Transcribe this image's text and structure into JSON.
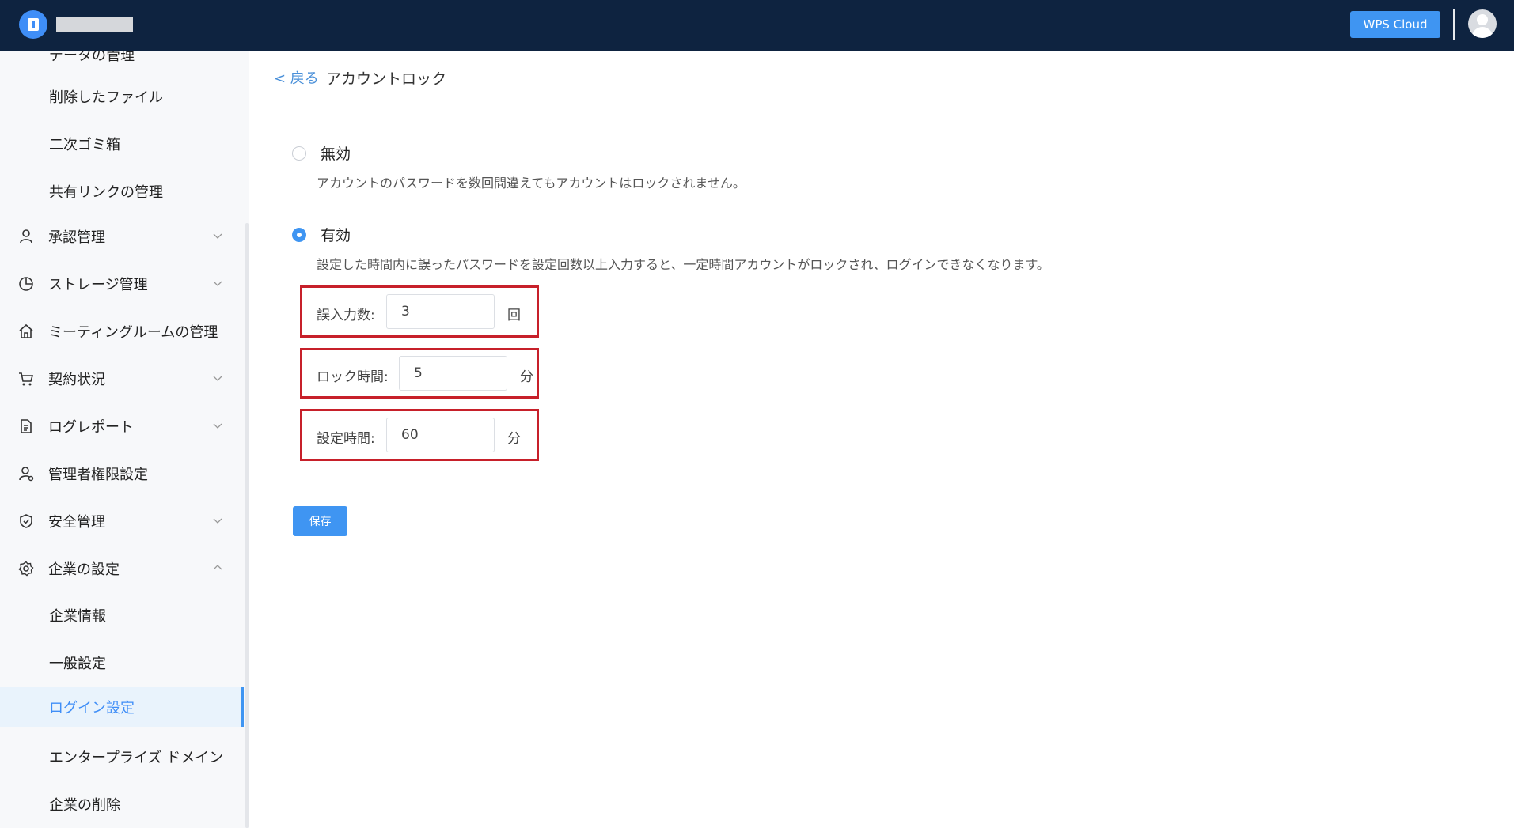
{
  "topbar": {
    "cloud_button_label": "WPS Cloud"
  },
  "sidebar": {
    "partial_label": "データの管理",
    "items": [
      {
        "label": "削除したファイル",
        "level": "sub"
      },
      {
        "label": "二次ゴミ箱",
        "level": "sub"
      },
      {
        "label": "共有リンクの管理",
        "level": "sub"
      },
      {
        "label": "承認管理",
        "level": "top",
        "icon": "user-icon",
        "chevron": "down"
      },
      {
        "label": "ストレージ管理",
        "level": "top",
        "icon": "pie-chart-icon",
        "chevron": "down"
      },
      {
        "label": "ミーティングルームの管理",
        "level": "top",
        "icon": "home-icon"
      },
      {
        "label": "契約状況",
        "level": "top",
        "icon": "cart-icon",
        "chevron": "down"
      },
      {
        "label": "ログレポート",
        "level": "top",
        "icon": "document-icon",
        "chevron": "down"
      },
      {
        "label": "管理者権限設定",
        "level": "top",
        "icon": "admin-user-icon"
      },
      {
        "label": "安全管理",
        "level": "top",
        "icon": "shield-icon",
        "chevron": "down"
      },
      {
        "label": "企業の設定",
        "level": "top",
        "icon": "gear-icon",
        "chevron": "up"
      },
      {
        "label": "企業情報",
        "level": "sub"
      },
      {
        "label": "一般設定",
        "level": "sub"
      },
      {
        "label": "ログイン設定",
        "level": "sub",
        "active": true
      },
      {
        "label": "エンタープライズ ドメイン",
        "level": "sub"
      },
      {
        "label": "企業の削除",
        "level": "sub"
      }
    ]
  },
  "header": {
    "back_label": "< 戻る",
    "title": "アカウントロック"
  },
  "options": {
    "disabled": {
      "label": "無効",
      "description": "アカウントのパスワードを数回間違えてもアカウントはロックされません。",
      "selected": false
    },
    "enabled": {
      "label": "有効",
      "description": "設定した時間内に誤ったパスワードを設定回数以上入力すると、一定時間アカウントがロックされ、ログインできなくなります。",
      "selected": true
    }
  },
  "fields": {
    "attempts": {
      "label": "誤入力数:",
      "value": "3",
      "unit": "回"
    },
    "lock_time": {
      "label": "ロック時間:",
      "value": "5",
      "unit": "分"
    },
    "window_time": {
      "label": "設定時間:",
      "value": "60",
      "unit": "分"
    }
  },
  "save_label": "保存",
  "colors": {
    "topbar": "#0e2340",
    "accent": "#3f95f2",
    "highlight_box": "#c7202a",
    "active_item_bg": "#e9f3fc"
  }
}
